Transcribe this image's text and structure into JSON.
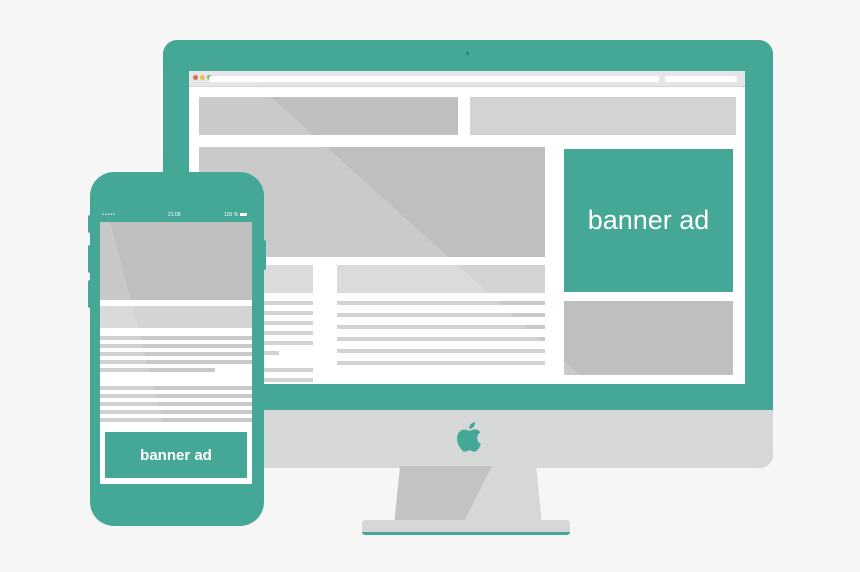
{
  "desktop": {
    "banner_label": "banner ad",
    "brand_icon": "apple-icon"
  },
  "phone": {
    "status_time": "21:08",
    "status_battery": "100 %",
    "banner_label": "banner ad"
  },
  "colors": {
    "accent": "#45a897",
    "placeholder_dark": "#bfbfbf",
    "placeholder_light": "#d4d4d4",
    "bezel_light": "#d6d8d8"
  }
}
